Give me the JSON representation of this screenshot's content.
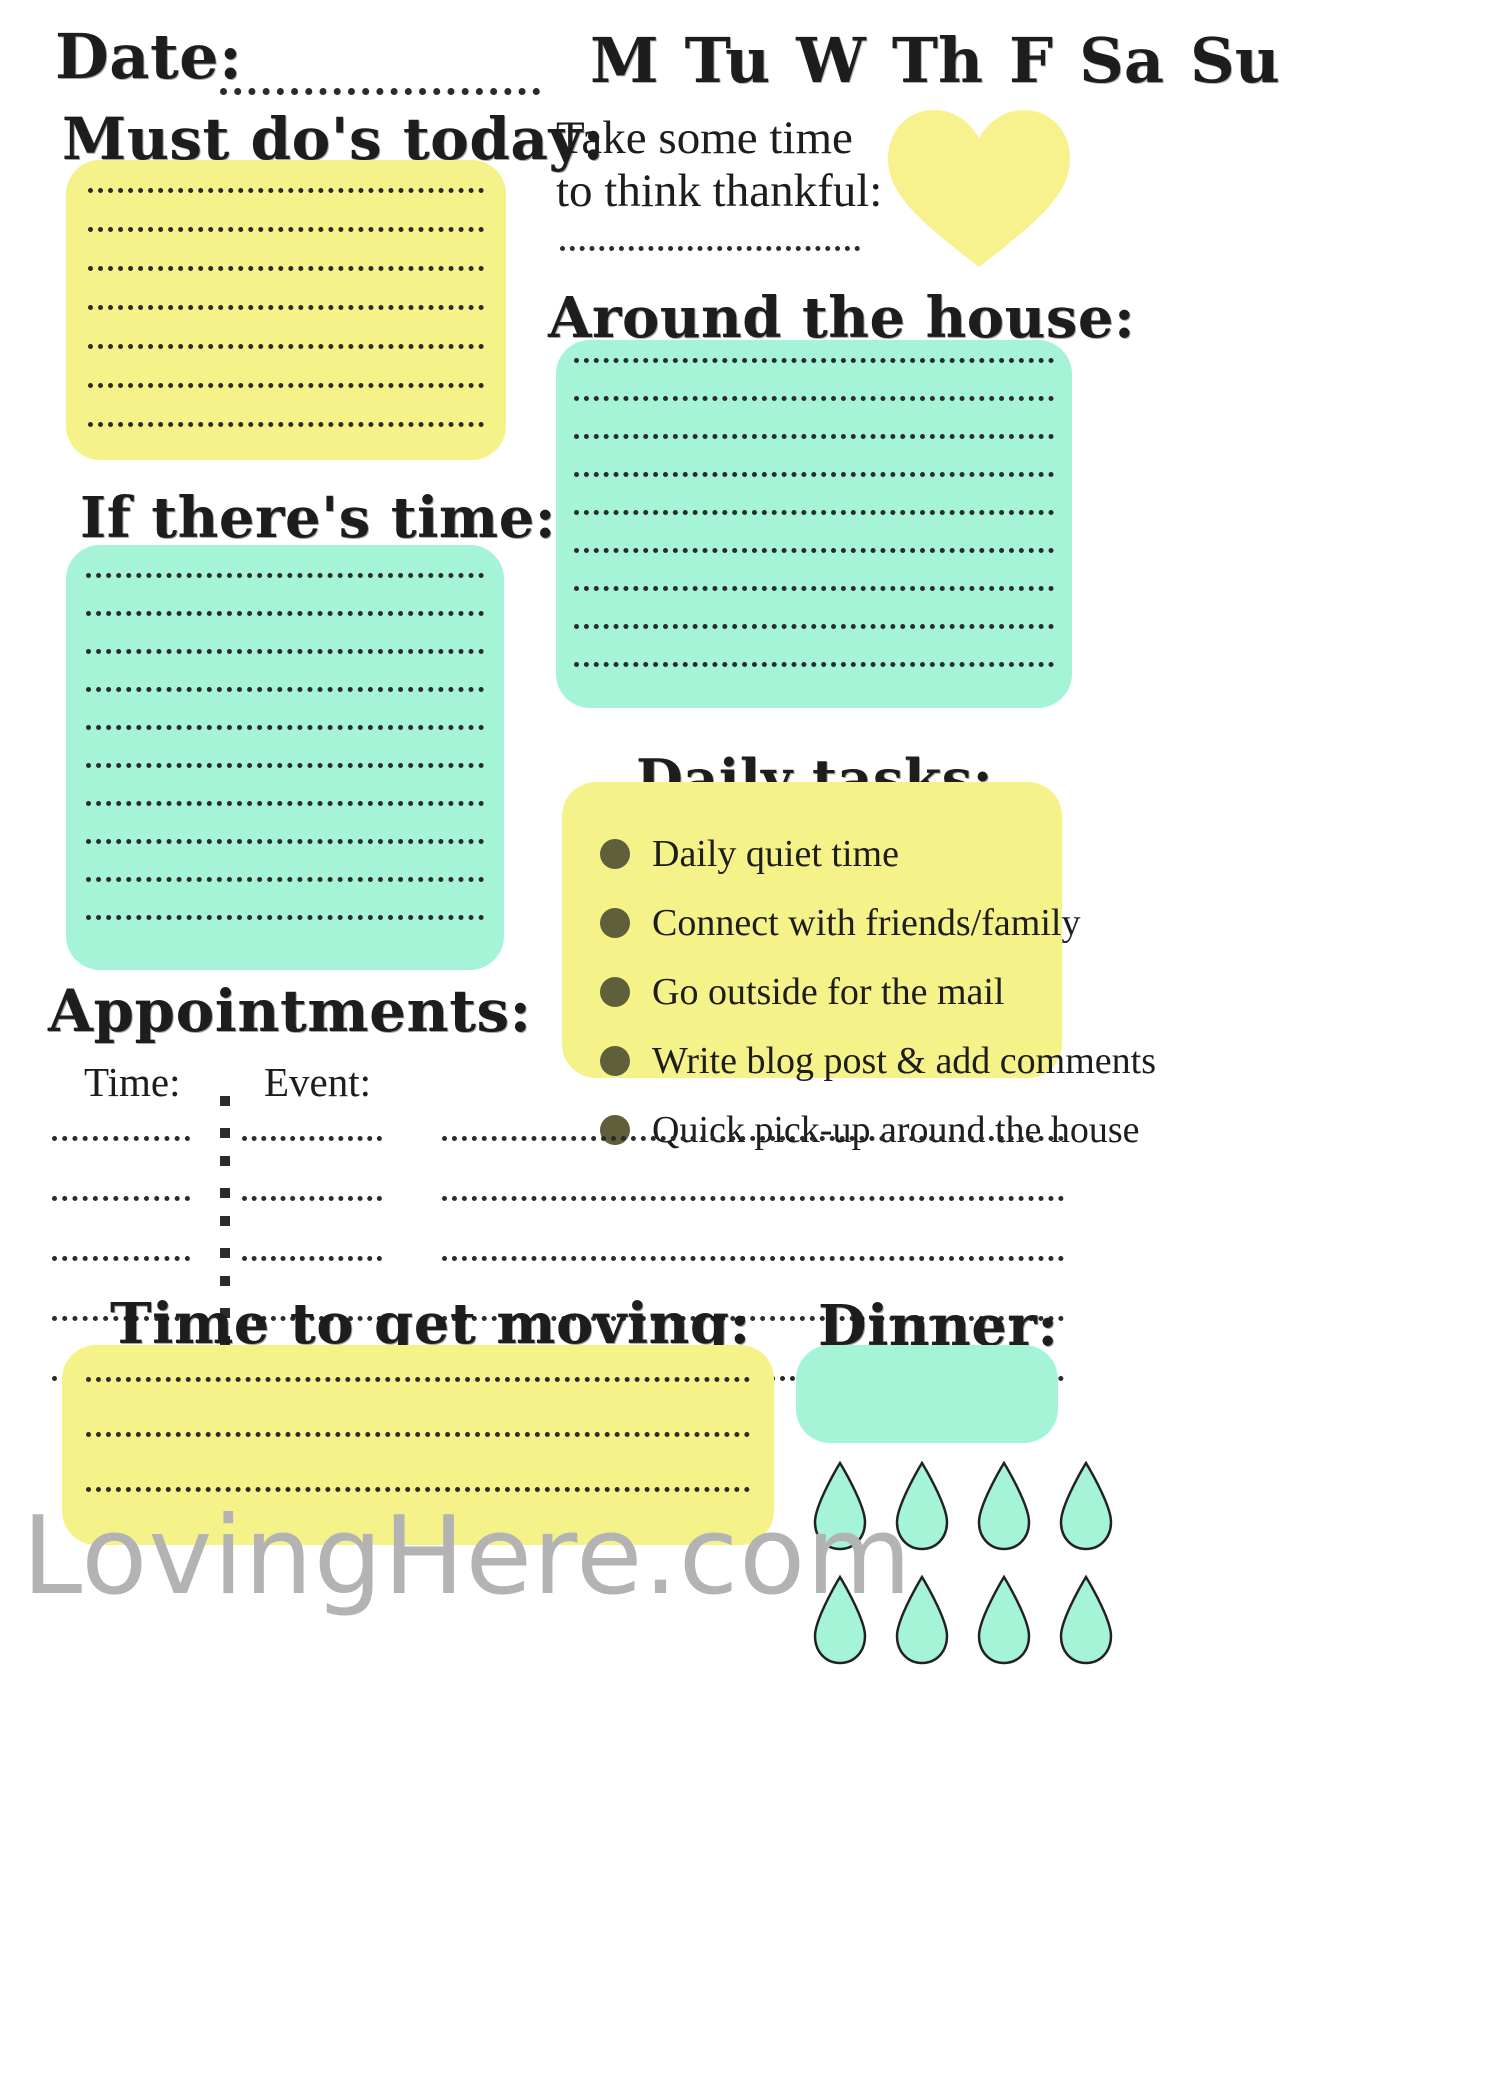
{
  "header": {
    "date_label": "Date:",
    "days": [
      "M",
      "Tu",
      "W",
      "Th",
      "F",
      "Sa",
      "Su"
    ]
  },
  "must_do": {
    "title": "Must do's today:",
    "line_count": 7
  },
  "thankful": {
    "line1": "Take some time",
    "line2": "to think thankful:",
    "icon": "heart-icon"
  },
  "around_house": {
    "title": "Around the house:",
    "line_count": 9
  },
  "if_time": {
    "title": "If there's time:",
    "line_count": 10
  },
  "daily_tasks": {
    "title": "Daily tasks:",
    "items": [
      "Daily quiet time",
      "Connect with friends/family",
      "Go outside  for the mail",
      "Write blog post & add comments",
      "Quick pick-up around the house"
    ]
  },
  "appointments": {
    "title": "Appointments:",
    "col_time": "Time:",
    "col_event": "Event:",
    "row_count": 5
  },
  "get_moving": {
    "title": "Time to get moving:",
    "line_count": 3
  },
  "dinner": {
    "title": "Dinner:",
    "water_drop_count": 8
  },
  "footer": {
    "watermark": "LovingHere.com"
  },
  "colors": {
    "yellow": "#f6f28a",
    "mint": "#a6f4d8",
    "ink": "#1d1d1b",
    "bullet": "#5f5f3c",
    "watermark_gray": "#b3b3b3"
  }
}
